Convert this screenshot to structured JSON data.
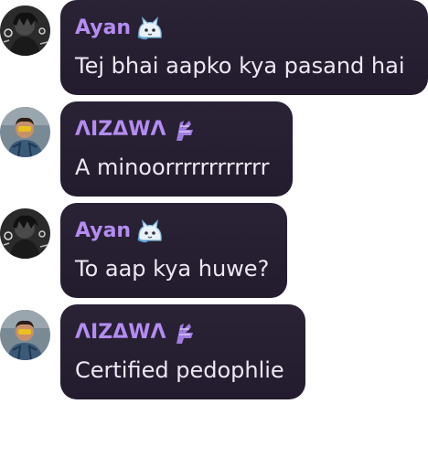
{
  "messages": [
    {
      "author": "Ayan",
      "text": "Tej bhai aapko kya pasand hai",
      "avatar_icon": "dark-anime-avatar",
      "badge_icon": "cat-sticker-icon"
    },
    {
      "author": "ΛIZΔWΛ",
      "text": "A minoorrrrrrrrrrrr",
      "avatar_icon": "person-photo-avatar",
      "badge_icon": "purple-emblem-icon"
    },
    {
      "author": "Ayan",
      "text": "To aap kya huwe?",
      "avatar_icon": "dark-anime-avatar",
      "badge_icon": "cat-sticker-icon"
    },
    {
      "author": "ΛIZΔWΛ",
      "text": "Certified pedophlie",
      "avatar_icon": "person-photo-avatar",
      "badge_icon": "purple-emblem-icon"
    }
  ],
  "colors": {
    "bubble_bg": "#261f31",
    "author_name": "#b48cf2",
    "message_text": "#ece8f2",
    "page_bg": "#ffffff"
  }
}
